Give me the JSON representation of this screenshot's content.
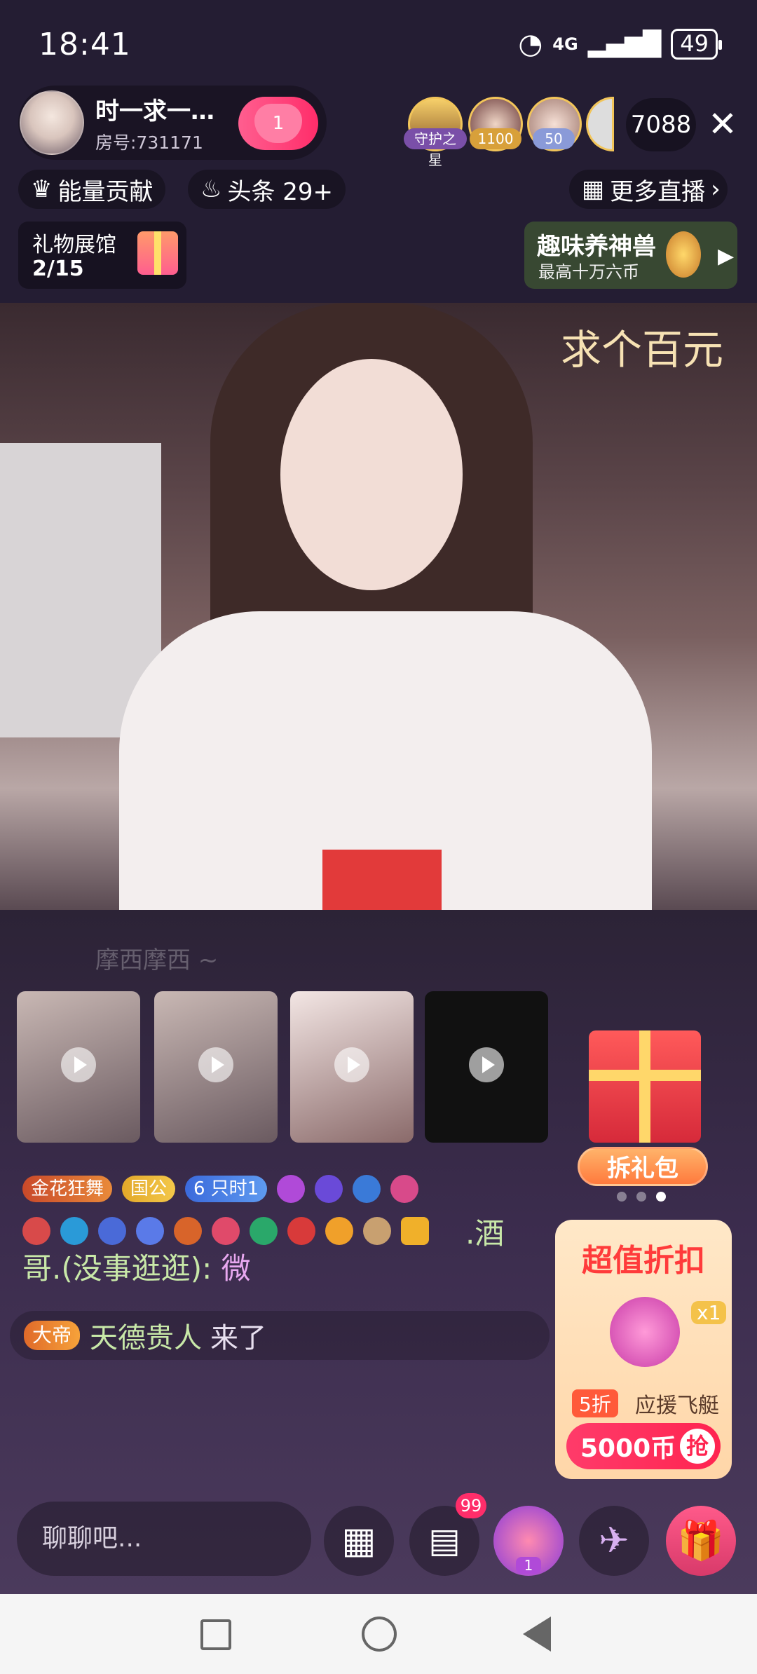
{
  "status": {
    "time": "18:41",
    "network": "4G",
    "battery": "49"
  },
  "host": {
    "name": "时一求一…",
    "room": "房号:731171",
    "fan_level": "1"
  },
  "audience": [
    {
      "badge": "守护之星",
      "color": "#7a4fa8"
    },
    {
      "badge": "1100",
      "color": "#d8a03a"
    },
    {
      "badge": "50",
      "color": "#8a9ad8"
    }
  ],
  "viewer_count": "7088",
  "close_glyph": "✕",
  "tags": {
    "energy": "能量贡献",
    "headline": "头条 29+",
    "more_live": "更多直播"
  },
  "gift_hall": {
    "title": "礼物展馆",
    "count": "2/15"
  },
  "game_card": {
    "title": "趣味养神兽",
    "subtitle": "最高十万六币"
  },
  "video_overlay_text": "求个百元",
  "chat_header_name": "摩西摩西 ~",
  "badges_row": [
    "金花狂舞",
    "国公",
    "6",
    "只时1"
  ],
  "chat_message": {
    "text_prefix": ".酒",
    "user": "哥.(没事逛逛):",
    "message": "微"
  },
  "enter_message": {
    "badge": "大帝",
    "user": "天德贵人",
    "action": "来了"
  },
  "promo": {
    "open_pack": "拆礼包",
    "deal_title": "超值折扣",
    "deal_qty": "x1",
    "discount": "5折",
    "item": "应援飞艇",
    "price": "5000币",
    "grab": "抢"
  },
  "bottom": {
    "placeholder": "聊聊吧...",
    "message_badge": "99",
    "throne_level": "1"
  },
  "colors": {
    "accent": "#ff2d6a",
    "bg": "#241d33"
  }
}
